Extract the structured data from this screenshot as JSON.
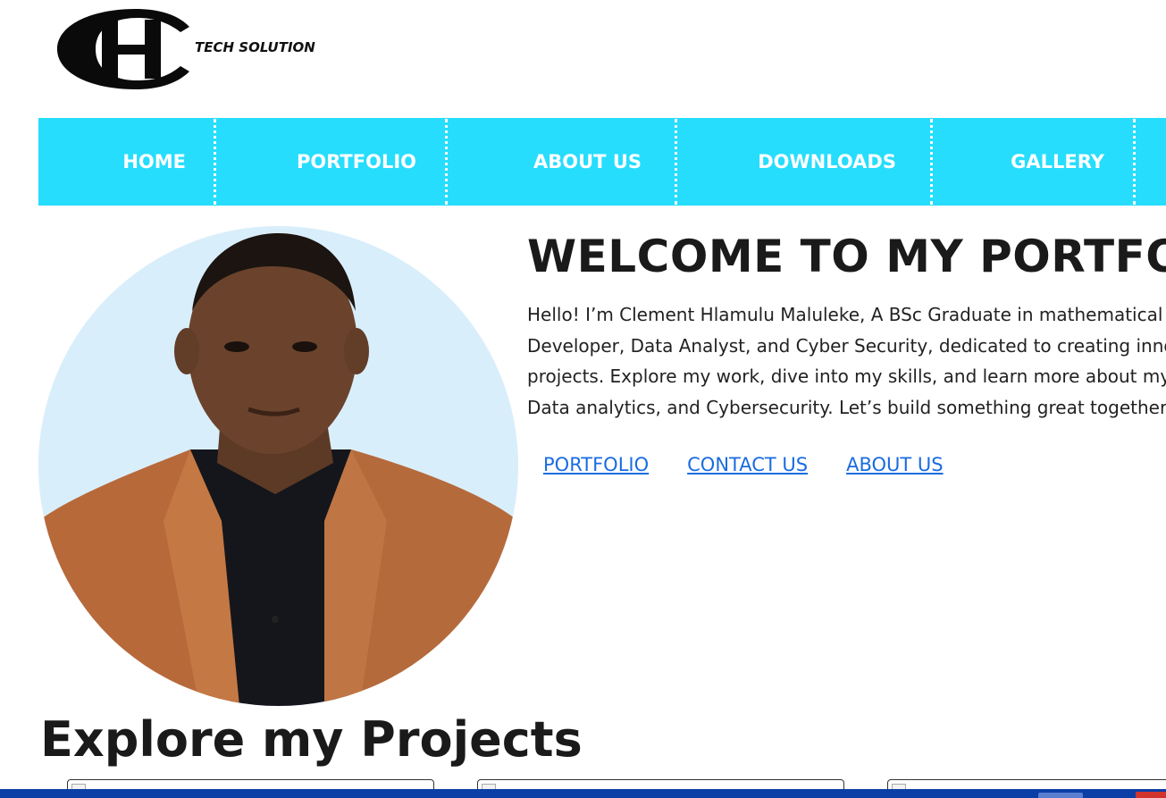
{
  "logo": {
    "text": "TECH SOLUTION",
    "letters": "CH"
  },
  "nav": {
    "items": [
      {
        "label": "HOME"
      },
      {
        "label": "PORTFOLIO"
      },
      {
        "label": "ABOUT US"
      },
      {
        "label": "DOWNLOADS"
      },
      {
        "label": "GALLERY"
      }
    ]
  },
  "hero": {
    "title": "WELCOME TO MY PORTFOL",
    "intro_lines": [
      "Hello! I’m Clement Hlamulu Maluleke, A BSc Graduate in mathematical",
      "Developer, Data Analyst, and Cyber Security, dedicated to creating inno",
      "projects. Explore my work, dive into my skills, and learn more about my",
      "Data analytics, and Cybersecurity. Let’s build something great together"
    ],
    "links": [
      {
        "label": "PORTFOLIO"
      },
      {
        "label": "CONTACT US"
      },
      {
        "label": "ABOUT US"
      }
    ]
  },
  "projects": {
    "title": "Explore my Projects"
  },
  "colors": {
    "nav_bg": "#26ddfd",
    "link": "#1a6ce0",
    "taskbar": "#0b3fa6"
  }
}
